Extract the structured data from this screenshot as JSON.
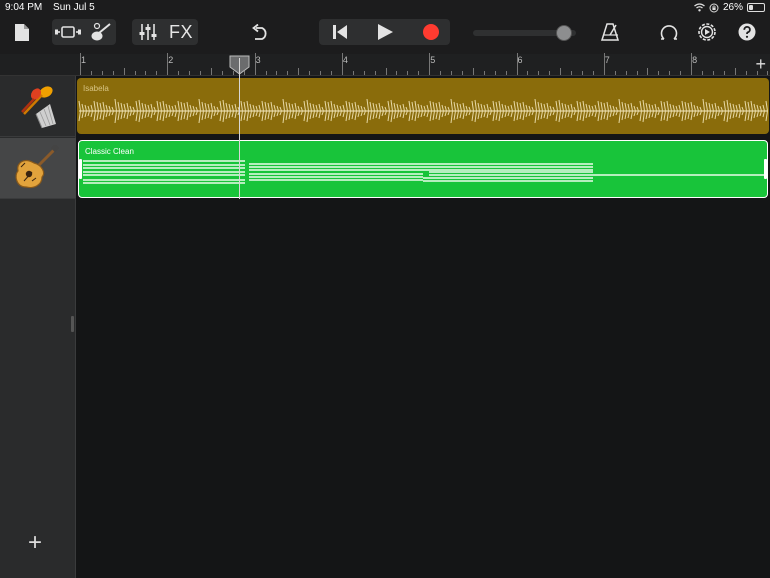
{
  "status_bar": {
    "time": "9:04 PM",
    "date": "Sun Jul 5",
    "battery": "26%",
    "battery_level": 0.26,
    "icons": [
      "wifi-icon",
      "orientation-lock-icon",
      "battery-icon"
    ]
  },
  "toolbar": {
    "fx_label": "FX",
    "icons": [
      "my-songs-icon",
      "browser-icon",
      "instrument-icon",
      "mixer-icon",
      "undo-icon",
      "go-to-beginning-icon",
      "play-icon",
      "record-icon",
      "metronome-icon",
      "loop-icon",
      "settings-icon",
      "help-icon"
    ],
    "record_color": "#ff3b30",
    "master_volume": 0.95
  },
  "ruler": {
    "bars": [
      "1",
      "2",
      "3",
      "4",
      "5",
      "6",
      "7",
      "8"
    ],
    "add_label": "+"
  },
  "tracks": [
    {
      "instrument_icon": "maracas-icon",
      "region_name": "Isabela",
      "region_color": "#8a6c0b"
    },
    {
      "instrument_icon": "guitar-icon",
      "region_name": "Classic Clean",
      "region_color": "#18c43a"
    }
  ],
  "sidebar": {
    "add_label": "+"
  },
  "playhead": {
    "position_bars": 2.85
  }
}
